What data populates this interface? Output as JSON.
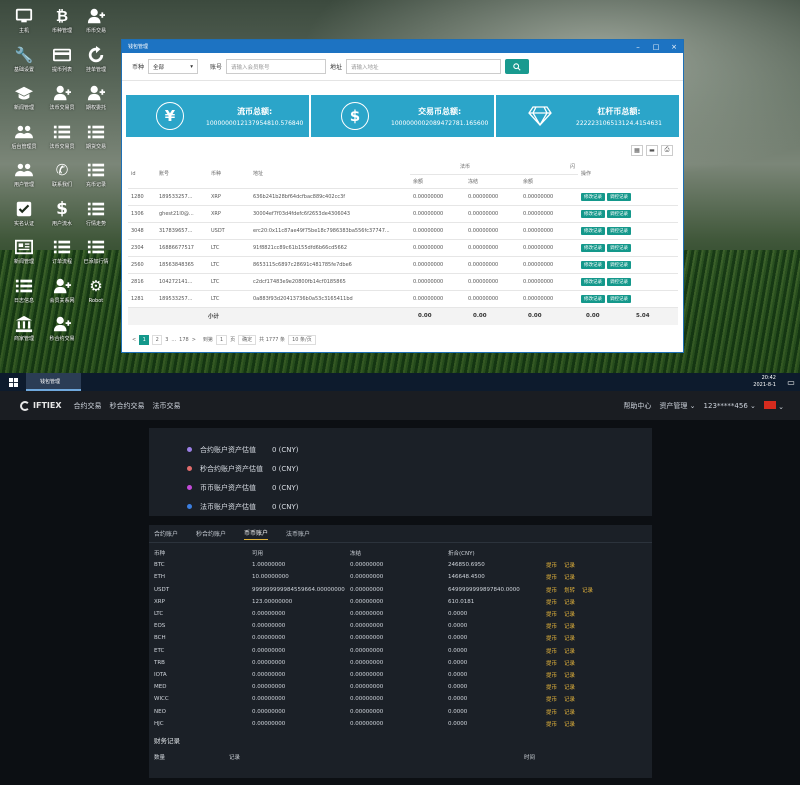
{
  "desktop": {
    "icons": [
      {
        "label": "主机",
        "glyph": "monitor-icon"
      },
      {
        "label": "币种管理",
        "glyph": "bitcoin-icon"
      },
      {
        "label": "币币交易",
        "glyph": "user-add-icon"
      },
      {
        "label": "基础设置",
        "glyph": "wrench-icon"
      },
      {
        "label": "提币列表",
        "glyph": "card-icon"
      },
      {
        "label": "挂单管理",
        "glyph": "refresh-icon"
      },
      {
        "label": "新闻管理",
        "glyph": "graduation-icon"
      },
      {
        "label": "法币交易员",
        "glyph": "user-add-icon"
      },
      {
        "label": "期权委托",
        "glyph": "user-add-icon"
      },
      {
        "label": "后台管理员",
        "glyph": "users-icon"
      },
      {
        "label": "法币交易员",
        "glyph": "list-icon"
      },
      {
        "label": "期货交易",
        "glyph": "list-icon"
      },
      {
        "label": "用户管理",
        "glyph": "users-icon"
      },
      {
        "label": "联系我们",
        "glyph": "phone-icon"
      },
      {
        "label": "充币记录",
        "glyph": "list-icon"
      },
      {
        "label": "实名认证",
        "glyph": "checkbox-icon"
      },
      {
        "label": "用户流水",
        "glyph": "dollar-icon"
      },
      {
        "label": "行情走势",
        "glyph": "list-icon"
      },
      {
        "label": "新闻管理",
        "glyph": "newspaper-icon"
      },
      {
        "label": "订单流程",
        "glyph": "list-icon"
      },
      {
        "label": "已添加行情",
        "glyph": "list-icon"
      },
      {
        "label": "日志信息",
        "glyph": "list-icon"
      },
      {
        "label": "会员关系网",
        "glyph": "user-add-icon"
      },
      {
        "label": "Robot",
        "glyph": "robot-icon"
      },
      {
        "label": "商家管理",
        "glyph": "bank-icon"
      },
      {
        "label": "秒合约交易",
        "glyph": "user-add-icon"
      }
    ]
  },
  "window": {
    "title": "钱包管理",
    "controls": [
      "–",
      "□",
      "×"
    ],
    "filter": {
      "currency_label": "币种",
      "currency_value": "全部",
      "account_label": "账号",
      "account_placeholder": "请输入会员账号",
      "address_label": "地址",
      "address_placeholder": "请输入地址"
    },
    "stats": [
      {
        "title": "流币总额:",
        "value": "1000000012137954810.576840",
        "icon": "yen-icon"
      },
      {
        "title": "交易币总额:",
        "value": "1000000002089472781.165600",
        "icon": "dollar-circle-icon"
      },
      {
        "title": "杠杆币总额:",
        "value": "222223106513124.4154631",
        "icon": "diamond-icon"
      }
    ],
    "tools": [
      "▦",
      "▬",
      "⎙"
    ],
    "columns": {
      "id": "id",
      "account": "账号",
      "currency": "币种",
      "address": "地址",
      "group1": "法币",
      "group2": "闪",
      "sub": [
        "余额",
        "冻结",
        "余额"
      ],
      "op": "操作"
    },
    "rows": [
      {
        "id": "1280",
        "acc": "189533257...",
        "cur": "XRP",
        "addr": "636b241b28bf64dcfbac889c402cc3f",
        "b1": "0.00000000",
        "b2": "0.00000000",
        "b3": "0.00000000"
      },
      {
        "id": "1306",
        "acc": "ghest21l0@...",
        "cur": "XRP",
        "addr": "30004ef7f03d4fdefc6f2653de4306043",
        "b1": "0.00000000",
        "b2": "0.00000000",
        "b3": "0.00000000"
      },
      {
        "id": "3048",
        "acc": "317839657...",
        "cur": "USDT",
        "addr": "erc20:0x11c87ae49f75be18c7986383ba556fc37747...",
        "b1": "0.00000000",
        "b2": "0.00000000",
        "b3": "0.00000000"
      },
      {
        "id": "2304",
        "acc": "16886677517",
        "cur": "LTC",
        "addr": "91f8821cc89c61b155dfd6b66cd5662",
        "b1": "0.00000000",
        "b2": "0.00000000",
        "b3": "0.00000000"
      },
      {
        "id": "2560",
        "acc": "18563848365",
        "cur": "LTC",
        "addr": "8653115c6897c28691c481785fe7dbe6",
        "b1": "0.00000000",
        "b2": "0.00000000",
        "b3": "0.00000000"
      },
      {
        "id": "2816",
        "acc": "104272141...",
        "cur": "LTC",
        "addr": "c2dcf17483e9e20800fb14cf0185865",
        "b1": "0.00000000",
        "b2": "0.00000000",
        "b3": "0.00000000"
      },
      {
        "id": "1281",
        "acc": "189533257...",
        "cur": "LTC",
        "addr": "0a883f93d20413736b0a53c3165411bd",
        "b1": "0.00000000",
        "b2": "0.00000000",
        "b3": "0.00000000"
      }
    ],
    "row_btn1": "修改记录",
    "row_btn2": "调控记录",
    "sum": {
      "label": "小计",
      "v1": "0.00",
      "v2": "0.00",
      "v3": "0.00",
      "v4": "0.00",
      "v5": "0.00",
      "v6": "5.04"
    },
    "pager": {
      "prev": "<",
      "p1": "1",
      "p2": "2",
      "p3": "3",
      "dots": "...",
      "last": "178",
      "next": ">",
      "goto": "到第",
      "page_input": "1",
      "page_unit": "页",
      "confirm": "确定",
      "total": "共 1777 条",
      "per_page": "10 条/页"
    }
  },
  "taskbar": {
    "task": "钱包管理",
    "time": "20:42",
    "date": "2021-8-1"
  },
  "site": {
    "brand": "IFTIEX",
    "nav": [
      "合约交易",
      "秒合约交易",
      "法币交易"
    ],
    "right": {
      "help": "帮助中心",
      "assets": "资产管理",
      "user": "123*****456"
    },
    "assets": [
      {
        "label": "合约账户资产估值",
        "value": "0 (CNY)",
        "color": "#9b7fe6"
      },
      {
        "label": "秒合约账户资产估值",
        "value": "0 (CNY)",
        "color": "#e26c6c"
      },
      {
        "label": "币币账户资产估值",
        "value": "0 (CNY)",
        "color": "#c44ad9"
      },
      {
        "label": "法币账户资产估值",
        "value": "0 (CNY)",
        "color": "#3b7ee0"
      }
    ],
    "tabs": [
      "合约账户",
      "秒合约账户",
      "币币账户",
      "法币账户"
    ],
    "wallet_headers": [
      "币种",
      "可用",
      "冻结",
      "折合(CNY)"
    ],
    "wallet_rows": [
      {
        "c": "BTC",
        "a": "1.00000000",
        "f": "0.00000000",
        "v": "246850.6950",
        "act": [
          "提币",
          "记录"
        ]
      },
      {
        "c": "ETH",
        "a": "10.00000000",
        "f": "0.00000000",
        "v": "146648.4500",
        "act": [
          "提币",
          "记录"
        ]
      },
      {
        "c": "USDT",
        "a": "999999999984559664.00000000",
        "f": "0.00000000",
        "v": "6499999999897840.0000",
        "act": [
          "提币",
          "划转",
          "记录"
        ]
      },
      {
        "c": "XRP",
        "a": "123.00000000",
        "f": "0.00000000",
        "v": "610.0181",
        "act": [
          "提币",
          "记录"
        ]
      },
      {
        "c": "LTC",
        "a": "0.00000000",
        "f": "0.00000000",
        "v": "0.0000",
        "act": [
          "提币",
          "记录"
        ]
      },
      {
        "c": "EOS",
        "a": "0.00000000",
        "f": "0.00000000",
        "v": "0.0000",
        "act": [
          "提币",
          "记录"
        ]
      },
      {
        "c": "BCH",
        "a": "0.00000000",
        "f": "0.00000000",
        "v": "0.0000",
        "act": [
          "提币",
          "记录"
        ]
      },
      {
        "c": "ETC",
        "a": "0.00000000",
        "f": "0.00000000",
        "v": "0.0000",
        "act": [
          "提币",
          "记录"
        ]
      },
      {
        "c": "TRB",
        "a": "0.00000000",
        "f": "0.00000000",
        "v": "0.0000",
        "act": [
          "提币",
          "记录"
        ]
      },
      {
        "c": "IOTA",
        "a": "0.00000000",
        "f": "0.00000000",
        "v": "0.0000",
        "act": [
          "提币",
          "记录"
        ]
      },
      {
        "c": "MED",
        "a": "0.00000000",
        "f": "0.00000000",
        "v": "0.0000",
        "act": [
          "提币",
          "记录"
        ]
      },
      {
        "c": "WICC",
        "a": "0.00000000",
        "f": "0.00000000",
        "v": "0.0000",
        "act": [
          "提币",
          "记录"
        ]
      },
      {
        "c": "NEO",
        "a": "0.00000000",
        "f": "0.00000000",
        "v": "0.0000",
        "act": [
          "提币",
          "记录"
        ]
      },
      {
        "c": "HJC",
        "a": "0.00000000",
        "f": "0.00000000",
        "v": "0.0000",
        "act": [
          "提币",
          "记录"
        ]
      }
    ],
    "finance_title": "财务记录",
    "finance_headers": [
      "数量",
      "记录",
      "时间"
    ]
  }
}
